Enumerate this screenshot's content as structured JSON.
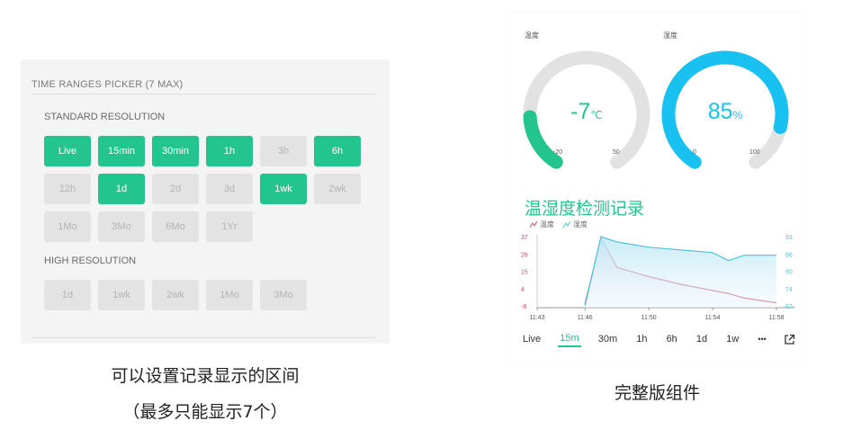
{
  "left_panel": {
    "title": "TIME RANGES PICKER (7 MAX)",
    "standard": {
      "label": "STANDARD RESOLUTION",
      "pills": [
        {
          "label": "Live",
          "active": true
        },
        {
          "label": "15min",
          "active": true
        },
        {
          "label": "30min",
          "active": true
        },
        {
          "label": "1h",
          "active": true
        },
        {
          "label": "3h",
          "active": false
        },
        {
          "label": "6h",
          "active": true
        },
        {
          "label": "12h",
          "active": false
        },
        {
          "label": "1d",
          "active": true
        },
        {
          "label": "2d",
          "active": false
        },
        {
          "label": "3d",
          "active": false
        },
        {
          "label": "1wk",
          "active": true
        },
        {
          "label": "2wk",
          "active": false
        },
        {
          "label": "1Mo",
          "active": false
        },
        {
          "label": "3Mo",
          "active": false
        },
        {
          "label": "6Mo",
          "active": false
        },
        {
          "label": "1Yr",
          "active": false
        }
      ]
    },
    "high": {
      "label": "HIGH RESOLUTION",
      "pills": [
        {
          "label": "1d",
          "active": false
        },
        {
          "label": "1wk",
          "active": false
        },
        {
          "label": "2wk",
          "active": false
        },
        {
          "label": "1Mo",
          "active": false
        },
        {
          "label": "3Mo",
          "active": false
        }
      ]
    },
    "caption_line1": "可以设置记录显示的区间",
    "caption_line2": "（最多只能显示7个）"
  },
  "gauges": [
    {
      "label": "温度",
      "value": "-7",
      "unit": "℃",
      "min": "-20",
      "max": "50",
      "fraction": 0.186,
      "color": "#23c48e"
    },
    {
      "label": "湿度",
      "value": "85",
      "unit": "%",
      "min": "0",
      "max": "100",
      "fraction": 0.85,
      "color": "#18c1f0"
    }
  ],
  "chart": {
    "title": "温湿度检测记录",
    "legend": [
      {
        "name": "温度",
        "color": "#c44d6d"
      },
      {
        "name": "湿度",
        "color": "#4bc5d8"
      }
    ]
  },
  "chart_data": {
    "type": "line",
    "x_ticks": [
      "11:43",
      "11:46",
      "11:50",
      "11:54",
      "11:58"
    ],
    "x": [
      "11:43",
      "11:46",
      "11:47",
      "11:48",
      "11:50",
      "11:52",
      "11:54",
      "11:55",
      "11:56",
      "11:58"
    ],
    "y_left_ticks": [
      "37",
      "26",
      "15",
      "4",
      "-8"
    ],
    "y_right_ticks": [
      "93",
      "86",
      "80",
      "74",
      "67-"
    ],
    "ylim_left": [
      -8,
      37
    ],
    "ylim_right": [
      67,
      93
    ],
    "series": [
      {
        "name": "温度",
        "axis": "left",
        "color": "#c44d6d",
        "values": [
          null,
          -7,
          36,
          17,
          11,
          6,
          2,
          0,
          -3,
          -6
        ]
      },
      {
        "name": "湿度",
        "axis": "right",
        "color": "#4bc5d8",
        "values": [
          null,
          67,
          93,
          91,
          89,
          88,
          87,
          84,
          86,
          86
        ]
      }
    ],
    "grid": false
  },
  "time_filters": {
    "items": [
      "Live",
      "15m",
      "30m",
      "1h",
      "6h",
      "1d",
      "1w"
    ],
    "active": "15m",
    "more": "•••"
  },
  "right_caption": "完整版组件"
}
